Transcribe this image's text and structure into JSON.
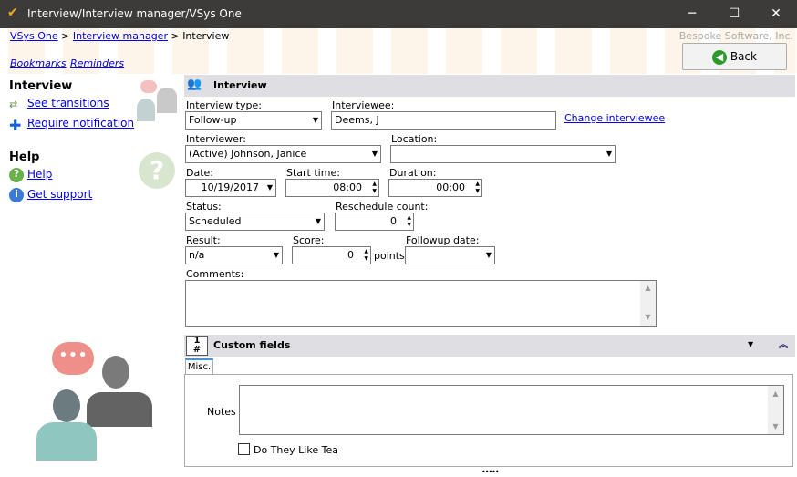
{
  "window": {
    "title": "Interview/Interview manager/VSys One",
    "minimize": "─",
    "maximize": "☐",
    "close": "✕"
  },
  "breadcrumb": {
    "items": [
      "VSys One",
      "Interview manager"
    ],
    "current": "Interview",
    "sep": ">"
  },
  "company": "Bespoke Software, Inc.",
  "links": {
    "bookmarks": "Bookmarks",
    "reminders": "Reminders"
  },
  "back_label": "Back",
  "sidebar": {
    "section1": "Interview",
    "items1": [
      "See transitions",
      "Require notification"
    ],
    "section2": "Help",
    "items2": [
      "Help",
      "Get support"
    ]
  },
  "form": {
    "header": "Interview",
    "interview_type": {
      "label": "Interview type:",
      "value": "Follow-up"
    },
    "interviewee": {
      "label": "Interviewee:",
      "value": "Deems, J",
      "change": "Change interviewee"
    },
    "interviewer": {
      "label": "Interviewer:",
      "value": "(Active) Johnson, Janice"
    },
    "location": {
      "label": "Location:",
      "value": ""
    },
    "date": {
      "label": "Date:",
      "value": "10/19/2017"
    },
    "start_time": {
      "label": "Start time:",
      "value": "08:00"
    },
    "duration": {
      "label": "Duration:",
      "value": "00:00"
    },
    "status": {
      "label": "Status:",
      "value": "Scheduled"
    },
    "reschedule": {
      "label": "Reschedule count:",
      "value": "0"
    },
    "result": {
      "label": "Result:",
      "value": "n/a"
    },
    "score": {
      "label": "Score:",
      "value": "0",
      "unit": "points"
    },
    "followup": {
      "label": "Followup date:",
      "value": ""
    },
    "comments": {
      "label": "Comments:",
      "value": ""
    }
  },
  "custom": {
    "header": "Custom fields",
    "tab": "Misc.",
    "notes_label": "Notes",
    "checkbox_label": "Do They Like Tea",
    "checked": false
  }
}
